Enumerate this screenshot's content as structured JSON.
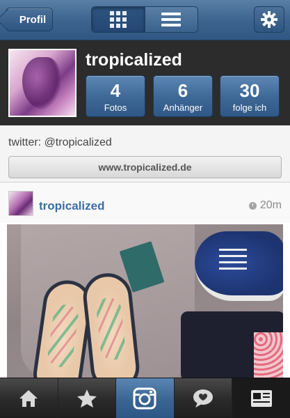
{
  "navbar": {
    "back_label": "Profil",
    "view_modes": [
      "grid-view",
      "list-view"
    ],
    "active_view": "grid-view",
    "settings_icon": "gear-icon"
  },
  "profile": {
    "username": "tropicalized",
    "stats": [
      {
        "value": "4",
        "label": "Fotos"
      },
      {
        "value": "6",
        "label": "Anhänger"
      },
      {
        "value": "30",
        "label": "folge ich"
      }
    ],
    "bio": "twitter: @tropicalized",
    "website": "www.tropicalized.de"
  },
  "post": {
    "username": "tropicalized",
    "time": "20m"
  },
  "tabbar": {
    "items": [
      "home-icon",
      "star-icon",
      "camera-icon",
      "chat-icon",
      "news-icon"
    ],
    "active": "camera-icon"
  },
  "colors": {
    "accent": "#3d6795",
    "link": "#3a6ea5",
    "header_bg": "#2c2c2c"
  }
}
